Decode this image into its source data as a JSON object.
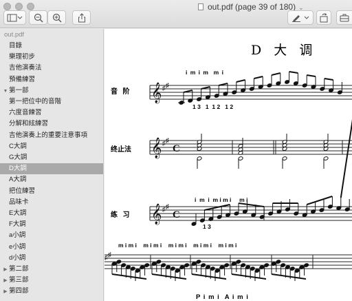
{
  "window": {
    "title": "out.pdf (page 39 of 180)"
  },
  "toolbar": {
    "sidebar_toggle": "sidebar-icon",
    "zoom_out": "zoom-out-icon",
    "zoom_in": "zoom-in-icon",
    "share": "share-icon",
    "markup": "pen-icon",
    "rotate": "rotate-icon",
    "toolbox": "toolbox-icon"
  },
  "sidebar": {
    "root": "out.pdf",
    "items": [
      {
        "label": "目錄",
        "level": 1
      },
      {
        "label": "樂理初步",
        "level": 1
      },
      {
        "label": "吉他演奏法",
        "level": 1
      },
      {
        "label": "預備練習",
        "level": 1
      },
      {
        "label": "第一部",
        "level": 0,
        "expanded": true
      },
      {
        "label": "第一把位中的音階",
        "level": 1
      },
      {
        "label": "六度音練習",
        "level": 1
      },
      {
        "label": "分解和絃練習",
        "level": 1
      },
      {
        "label": "吉他演奏上的重要注意事項",
        "level": 1
      },
      {
        "label": "C大調",
        "level": 1
      },
      {
        "label": "G大調",
        "level": 1
      },
      {
        "label": "D大調",
        "level": 1,
        "selected": true
      },
      {
        "label": "A大調",
        "level": 1
      },
      {
        "label": "把位練習",
        "level": 1
      },
      {
        "label": "品味卡",
        "level": 1
      },
      {
        "label": "E大調",
        "level": 1
      },
      {
        "label": "F大調",
        "level": 1
      },
      {
        "label": "a小調",
        "level": 1
      },
      {
        "label": "e小調",
        "level": 1
      },
      {
        "label": "d小調",
        "level": 1
      },
      {
        "label": "第二部",
        "level": 0,
        "expanded": false
      },
      {
        "label": "第三部",
        "level": 0,
        "expanded": false
      },
      {
        "label": "第四部",
        "level": 0,
        "expanded": false
      }
    ]
  },
  "document": {
    "heading": "D 大 调",
    "rows": [
      {
        "label": "音 阶",
        "fingering_above": "i m i m  m i",
        "fingering_below": "1 3   1  1 2   1 2"
      },
      {
        "label": "终止法",
        "meter": "c"
      },
      {
        "label": "练 习",
        "fingering_above": "i  m  i  m i m i     m i",
        "fingering_below": "1 3"
      }
    ],
    "row4_fingering_above": "m i m i    m i m i    m i m i    m i m i    m i m i",
    "bottom_text": "P i m i  A i m i"
  }
}
